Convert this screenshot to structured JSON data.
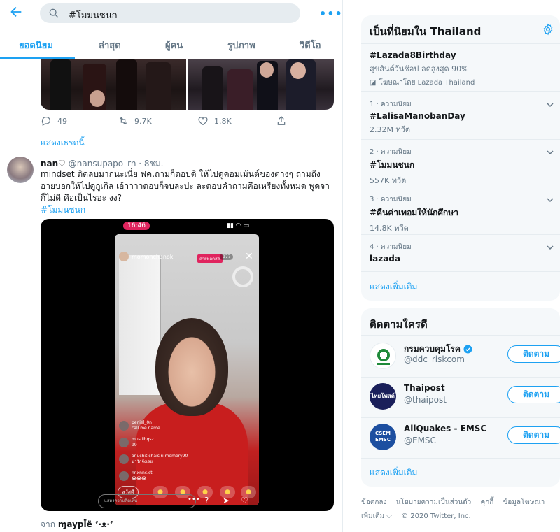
{
  "search": {
    "query": "#โมมนชนก"
  },
  "tabs": [
    "ยอดนิยม",
    "ล่าสุด",
    "ผู้คน",
    "รูปภาพ",
    "วิดีโอ"
  ],
  "prev_tweet": {
    "replies": "49",
    "retweets": "9.7K",
    "likes": "1.8K",
    "show_thread": "แสดงเธรดนี้"
  },
  "tweet": {
    "name": "nan♡",
    "handle": "@nansupapo_rn",
    "time": "8ชม.",
    "text": "mindset ติดลบมากนะเนี่ย ฟค.ถามก็ตอบดิ ให้ไปดูคอมเม้นต์ของต่างๆ ถามถึงอายบอกให้ไปดูกูเกิล เอ้าาาาตอบก็จบละปะ ละตอบคำถามคือเหรียงทั้งหมด พูดจาก็ไม่ดี คือเป็นไรอะ งง?",
    "hashtag": "#โมมนชนก",
    "source_prefix": "จาก",
    "source_app": "ɱaypl̈ë ᶠ·ᴥ·ᶠ"
  },
  "video": {
    "time": "16:46",
    "status": "▮▮ ◠ ▭",
    "streamer": "momonchanok",
    "live": "ถ่ายทอดสด",
    "viewers": "977",
    "comments": [
      {
        "user": "peniel_0n",
        "text": "call me name"
      },
      {
        "user": "musliihqsz",
        "text": "99"
      },
      {
        "user": "anuchit.chaisiri.memory90",
        "text": "น่ารักจังเลย"
      },
      {
        "user": "nnxnnc.ct",
        "text": "😂😂😂"
      }
    ],
    "hello": "สวัสดี",
    "comment_placeholder": "แสดงความคิดเห็น"
  },
  "trends": {
    "title": "เป็นที่นิยมใน Thailand",
    "items": [
      {
        "meta": "",
        "name": "#Lazada8Birthday",
        "count": "สุขสันต์วันช้อป ลดสูงสุด 90%",
        "promo": "โฆษณาโดย Lazada Thailand"
      },
      {
        "meta": "1 · ความนิยม",
        "name": "#LalisaManobanDay",
        "count": "2.32M ทวีต"
      },
      {
        "meta": "2 · ความนิยม",
        "name": "#โมมนชนก",
        "count": "557K ทวีต"
      },
      {
        "meta": "3 · ความนิยม",
        "name": "#คืนค่าเทอมให้นักศึกษา",
        "count": "14.8K ทวีต"
      },
      {
        "meta": "4 · ความนิยม",
        "name": "lazada",
        "count": ""
      }
    ],
    "show_more": "แสดงเพิ่มเติม"
  },
  "who_to_follow": {
    "title": "ติดตามใครดี",
    "items": [
      {
        "name": "กรมควบคุมโรค",
        "handle": "@ddc_riskcom",
        "button": "ติดตาม",
        "verified": true
      },
      {
        "name": "Thaipost",
        "handle": "@thaipost",
        "button": "ติดตาม",
        "avatar_text": "ไทยโพสต์"
      },
      {
        "name": "AllQuakes - EMSC",
        "handle": "@EMSC",
        "button": "ติดตาม",
        "avatar_text": "CSEM EMSC"
      }
    ],
    "show_more": "แสดงเพิ่มเติม"
  },
  "footer": {
    "links": [
      "ข้อตกลง",
      "นโยบายความเป็นส่วนตัว",
      "คุกกี้",
      "ข้อมูลโฆษณา",
      "เพิ่มเติม ⌵"
    ],
    "copyright": "© 2020 Twitter, Inc."
  },
  "colors": {
    "accent": "#1da1f2",
    "muted": "#657786",
    "card_bg": "#f5f8fa"
  }
}
